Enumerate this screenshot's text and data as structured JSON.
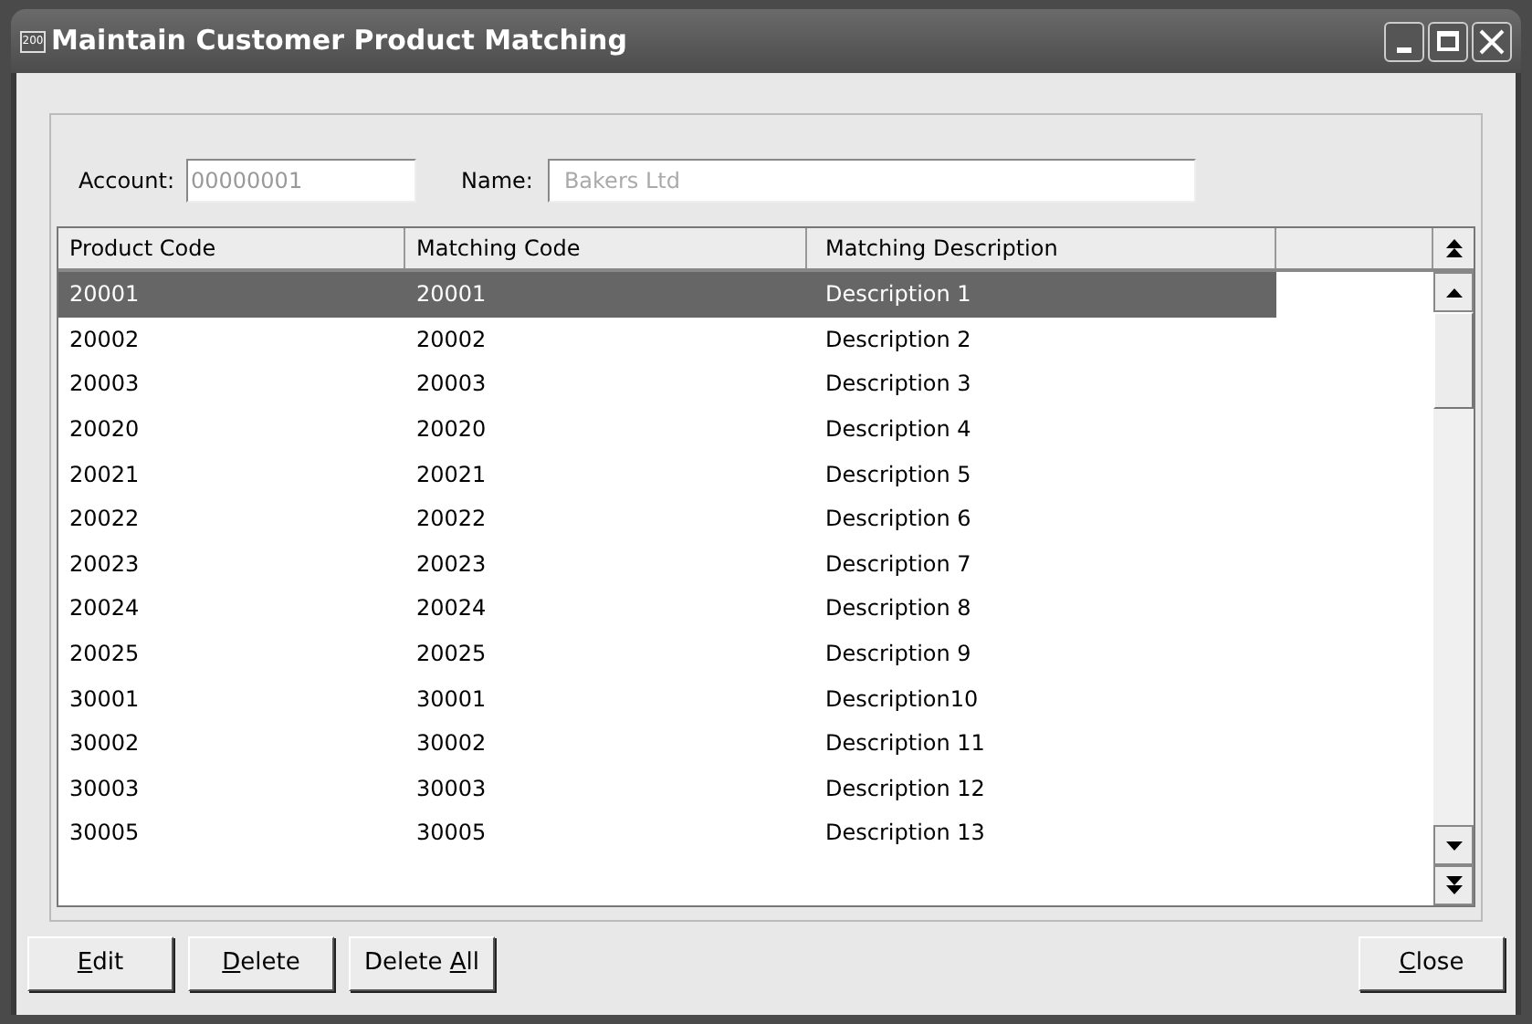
{
  "window": {
    "title": "Maintain Customer Product Matching",
    "icon_text": "200"
  },
  "account": {
    "label": "Account:",
    "value": "00000001"
  },
  "name": {
    "label": "Name:",
    "value": "Bakers Ltd"
  },
  "table": {
    "columns": [
      "Product Code",
      "Matching Code",
      "Matching Description"
    ],
    "rows": [
      {
        "cells": [
          "20001",
          "20001",
          "Description 1"
        ],
        "selected": true
      },
      {
        "cells": [
          "20002",
          "20002",
          "Description 2"
        ],
        "selected": false
      },
      {
        "cells": [
          "20003",
          "20003",
          "Description 3"
        ],
        "selected": false
      },
      {
        "cells": [
          "20020",
          "20020",
          "Description 4"
        ],
        "selected": false
      },
      {
        "cells": [
          "20021",
          "20021",
          "Description 5"
        ],
        "selected": false
      },
      {
        "cells": [
          "20022",
          "20022",
          "Description 6"
        ],
        "selected": false
      },
      {
        "cells": [
          "20023",
          "20023",
          "Description 7"
        ],
        "selected": false
      },
      {
        "cells": [
          "20024",
          "20024",
          "Description 8"
        ],
        "selected": false
      },
      {
        "cells": [
          "20025",
          "20025",
          "Description 9"
        ],
        "selected": false
      },
      {
        "cells": [
          "30001",
          "30001",
          "Description10"
        ],
        "selected": false
      },
      {
        "cells": [
          "30002",
          "30002",
          "Description 11"
        ],
        "selected": false
      },
      {
        "cells": [
          "30003",
          "30003",
          "Description 12"
        ],
        "selected": false
      },
      {
        "cells": [
          "30005",
          "30005",
          "Description 13"
        ],
        "selected": false
      }
    ]
  },
  "left_buttons": [
    {
      "key": "E",
      "rest": "dit"
    },
    {
      "key": "D",
      "rest": "elete"
    },
    {
      "lead": "Delete ",
      "key": "A",
      "rest": "ll"
    }
  ],
  "right_buttons": [
    {
      "key": "C",
      "rest": "lose"
    }
  ]
}
